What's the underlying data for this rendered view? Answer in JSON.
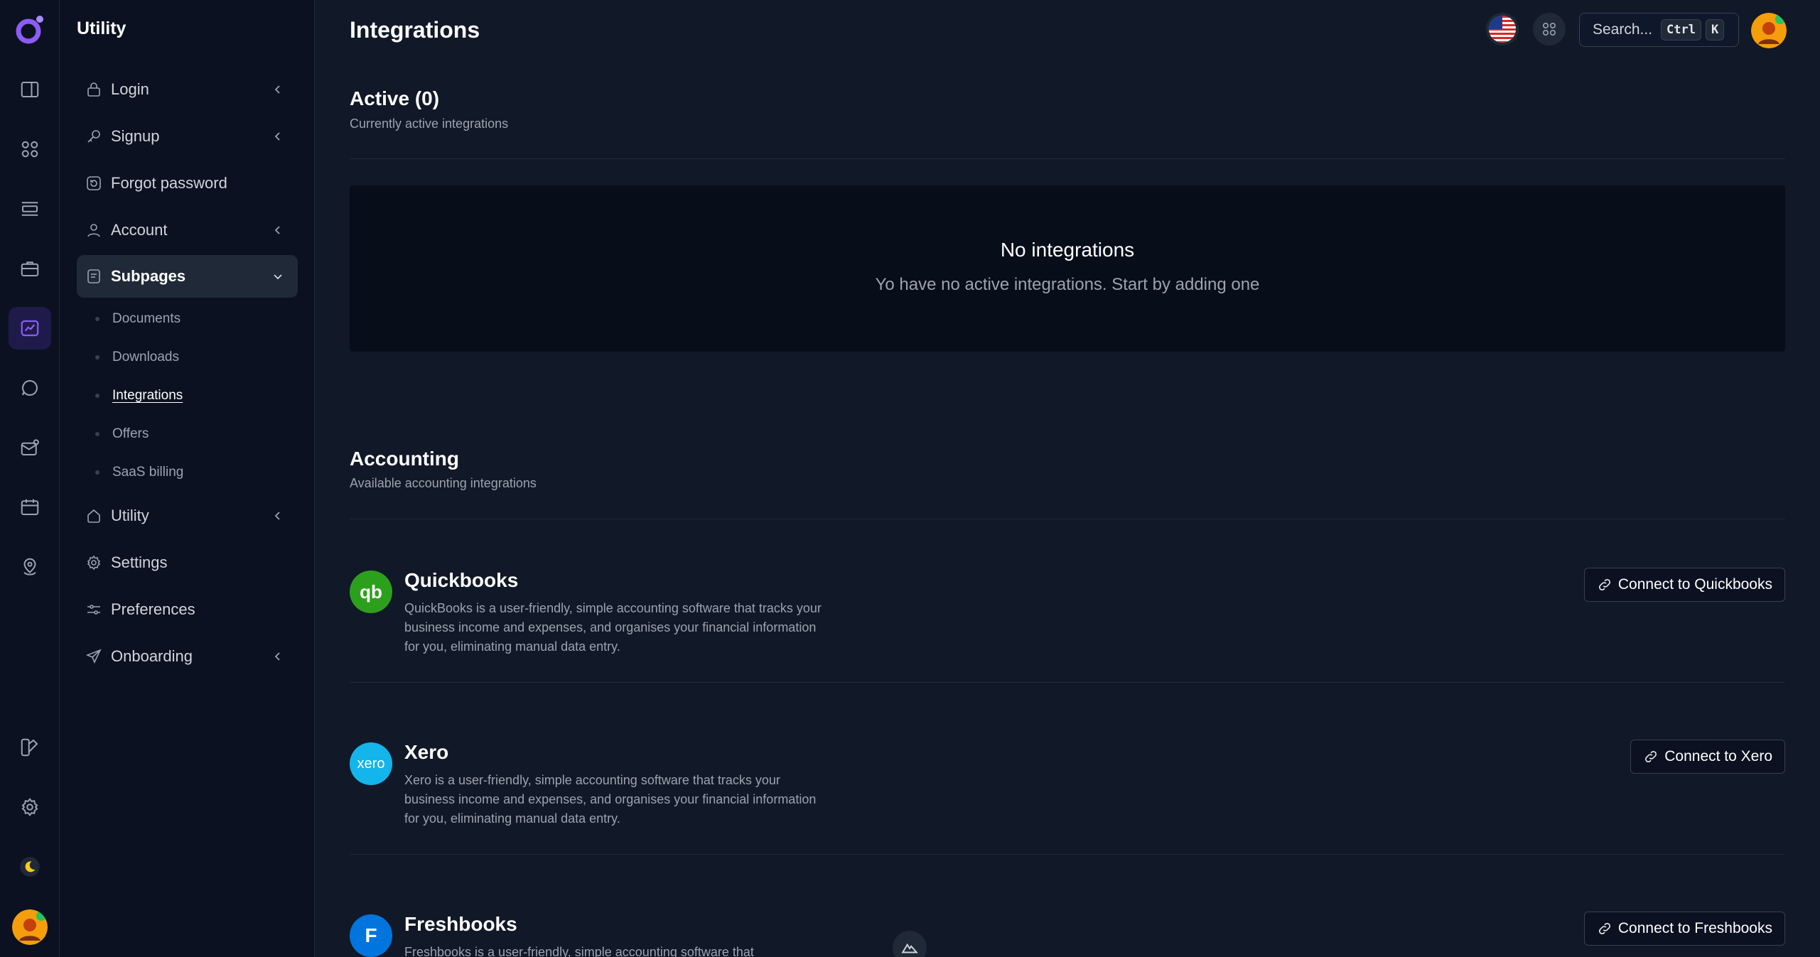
{
  "app": {
    "sidebar_title": "Utility"
  },
  "rail": {
    "items": [
      "layout-icon",
      "apps-icon",
      "list-icon",
      "briefcase-icon",
      "chart-icon",
      "chat-icon",
      "mail-icon",
      "calendar-icon",
      "map-pin-icon"
    ],
    "bottom_items": [
      "brush-icon",
      "gear-icon",
      "moon-icon"
    ]
  },
  "sidebar": {
    "items": [
      {
        "label": "Login",
        "icon": "lock-icon",
        "has_chevron": true
      },
      {
        "label": "Signup",
        "icon": "key-icon",
        "has_chevron": true
      },
      {
        "label": "Forgot password",
        "icon": "reset-icon",
        "has_chevron": false
      },
      {
        "label": "Account",
        "icon": "user-icon",
        "has_chevron": true
      },
      {
        "label": "Subpages",
        "icon": "page-icon",
        "has_chevron": true,
        "open": true
      },
      {
        "label": "Utility",
        "icon": "home-icon",
        "has_chevron": true
      },
      {
        "label": "Settings",
        "icon": "gear-icon",
        "has_chevron": false
      },
      {
        "label": "Preferences",
        "icon": "sliders-icon",
        "has_chevron": false
      },
      {
        "label": "Onboarding",
        "icon": "send-icon",
        "has_chevron": true
      }
    ],
    "subpages": [
      {
        "label": "Documents"
      },
      {
        "label": "Downloads"
      },
      {
        "label": "Integrations",
        "current": true
      },
      {
        "label": "Offers"
      },
      {
        "label": "SaaS billing"
      }
    ]
  },
  "header": {
    "title": "Integrations",
    "search_placeholder": "Search...",
    "kbd_1": "Ctrl",
    "kbd_2": "K"
  },
  "active": {
    "title": "Active (0)",
    "subtitle": "Currently active integrations",
    "empty_title": "No integrations",
    "empty_text": "Yo have no active integrations. Start by adding one"
  },
  "accounting": {
    "title": "Accounting",
    "subtitle": "Available accounting integrations",
    "integrations": [
      {
        "name": "Quickbooks",
        "logo_text": "qb",
        "color": "#2ca01c",
        "description": "QuickBooks is a user-friendly, simple accounting software that tracks your business income and expenses, and organises your financial information for you, eliminating manual data entry.",
        "button": "Connect to Quickbooks"
      },
      {
        "name": "Xero",
        "logo_text": "xero",
        "color": "#13b5ea",
        "description": "Xero is a user-friendly, simple accounting software that tracks your business income and expenses, and organises your financial information for you, eliminating manual data entry.",
        "button": "Connect to Xero"
      },
      {
        "name": "Freshbooks",
        "logo_text": "F",
        "color": "#0075dd",
        "description": "Freshbooks is a user-friendly, simple accounting software that",
        "button": "Connect to Freshbooks"
      }
    ]
  },
  "colors": {
    "accent": "#8b5cf6",
    "background": "#111827",
    "sidebar": "#0b1120"
  }
}
